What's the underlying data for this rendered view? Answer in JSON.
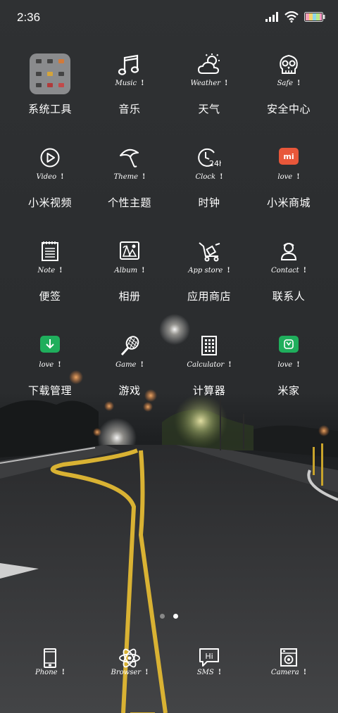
{
  "status_bar": {
    "time": "2:36"
  },
  "grid": [
    {
      "name": "系统工具",
      "sub": ""
    },
    {
      "name": "音乐",
      "sub": "Music"
    },
    {
      "name": "天气",
      "sub": "Weather"
    },
    {
      "name": "安全中心",
      "sub": "Safe"
    },
    {
      "name": "小米视频",
      "sub": "Video"
    },
    {
      "name": "个性主题",
      "sub": "Theme"
    },
    {
      "name": "时钟",
      "sub": "Clock"
    },
    {
      "name": "小米商城",
      "sub": "love"
    },
    {
      "name": "便签",
      "sub": "Note"
    },
    {
      "name": "相册",
      "sub": "Album"
    },
    {
      "name": "应用商店",
      "sub": "App store"
    },
    {
      "name": "联系人",
      "sub": "Contact"
    },
    {
      "name": "下载管理",
      "sub": "love"
    },
    {
      "name": "游戏",
      "sub": "Game"
    },
    {
      "name": "计算器",
      "sub": "Calculator"
    },
    {
      "name": "米家",
      "sub": "love"
    }
  ],
  "dock": [
    {
      "sub": "Phone"
    },
    {
      "sub": "Browser"
    },
    {
      "sub": "SMS"
    },
    {
      "sub": "Camera"
    }
  ],
  "clock_icon_text": "24h",
  "mi_logo_text": "mi",
  "sms_icon_text": "Hi",
  "pages": {
    "count": 2,
    "active": 2
  },
  "colors": {
    "accent_orange": "#e8573a",
    "accent_green": "#1fae5c",
    "line_yellow": "#d9b233"
  }
}
